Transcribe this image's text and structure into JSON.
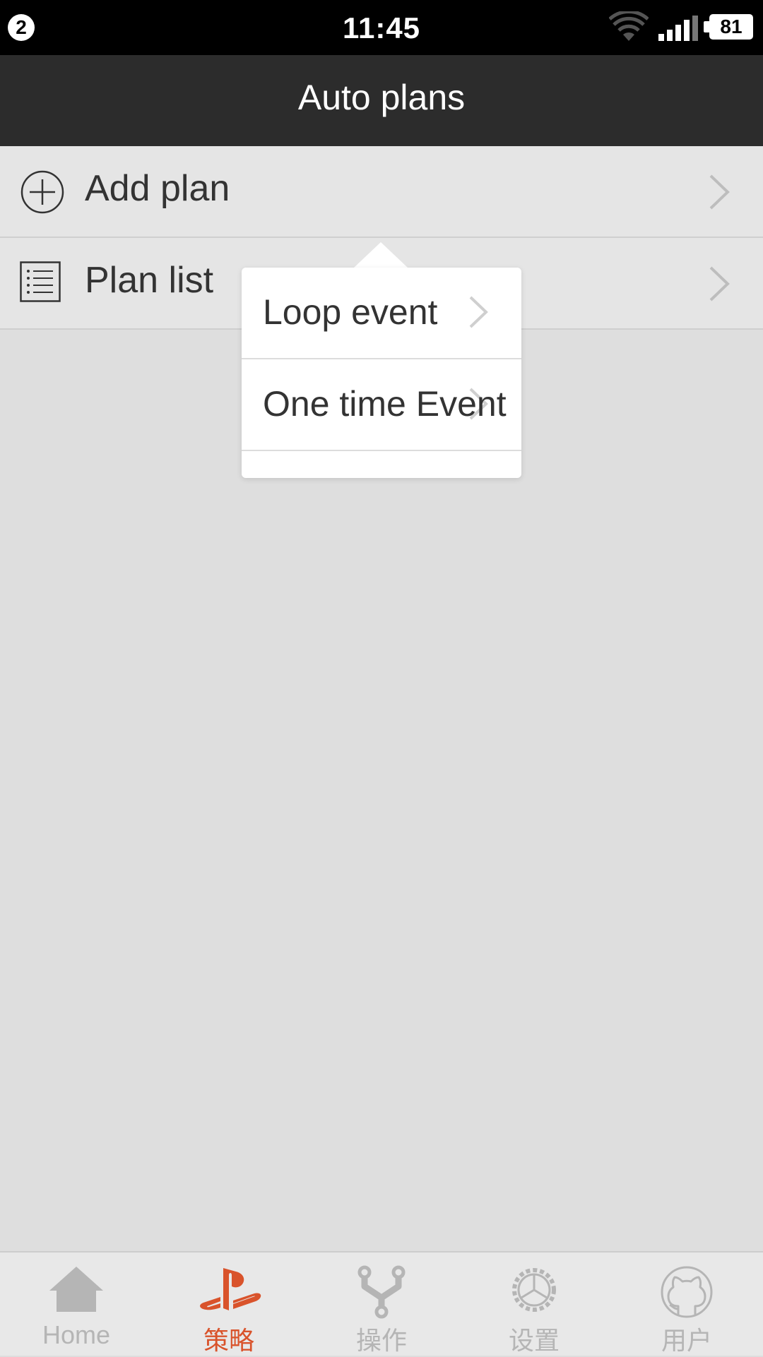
{
  "status_bar": {
    "notification_count": "2",
    "time": "11:45",
    "battery": "81"
  },
  "header": {
    "title": "Auto plans"
  },
  "menu": {
    "items": [
      {
        "label": "Add plan",
        "icon": "add-circle-icon"
      },
      {
        "label": "Plan list",
        "icon": "list-icon"
      }
    ]
  },
  "popover": {
    "items": [
      {
        "label": "Loop event"
      },
      {
        "label": "One time Event"
      }
    ]
  },
  "tabs": [
    {
      "label": "Home",
      "icon": "home-icon",
      "active": false
    },
    {
      "label": "策略",
      "icon": "playstation-icon",
      "active": true
    },
    {
      "label": "操作",
      "icon": "fork-icon",
      "active": false
    },
    {
      "label": "设置",
      "icon": "gear-icon",
      "active": false
    },
    {
      "label": "用户",
      "icon": "github-icon",
      "active": false
    }
  ],
  "colors": {
    "accent": "#d9532b",
    "header_bg": "#2c2c2c",
    "tab_inactive": "#b5b5b5"
  }
}
